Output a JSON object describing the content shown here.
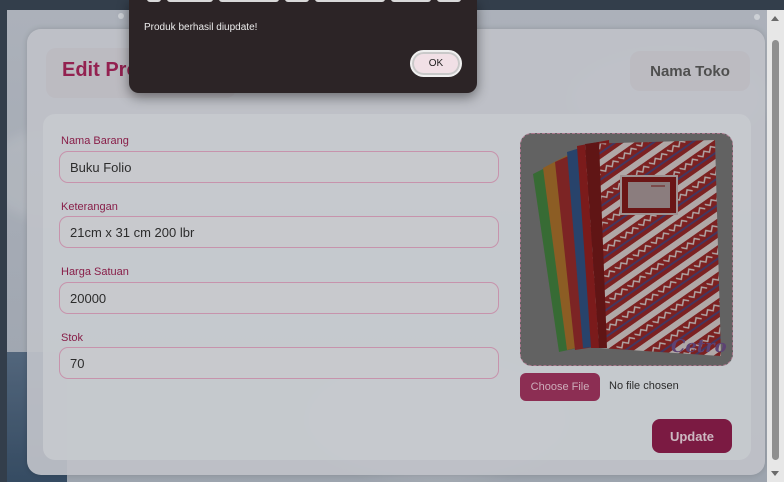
{
  "dialog": {
    "message": "Produk berhasil diupdate!",
    "ok_label": "OK"
  },
  "header": {
    "title": "Edit Produk",
    "store_name": "Nama Toko"
  },
  "form": {
    "nama_barang": {
      "label": "Nama Barang",
      "value": "Buku Folio"
    },
    "keterangan": {
      "label": "Keterangan",
      "value": "21cm x 31 cm 200 lbr"
    },
    "harga_satuan": {
      "label": "Harga Satuan",
      "value": "20000"
    },
    "stok": {
      "label": "Stok",
      "value": "70"
    }
  },
  "image_upload": {
    "choose_file_label": "Choose File",
    "status": "No file chosen",
    "brand_mark": "Cetro"
  },
  "actions": {
    "update_label": "Update"
  },
  "colors": {
    "accent": "#a8265c",
    "button": "#8c1e4c",
    "dialog_bg": "#2c2426"
  }
}
